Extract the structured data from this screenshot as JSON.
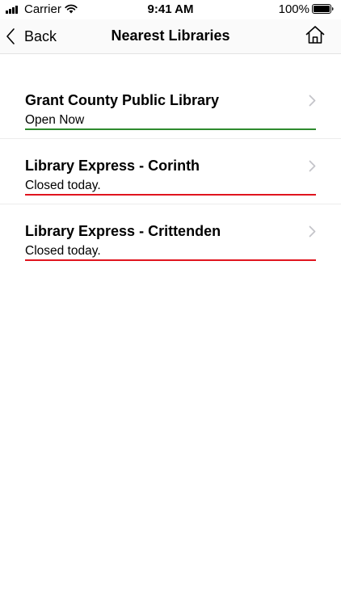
{
  "status_bar": {
    "carrier": "Carrier",
    "time": "9:41 AM",
    "battery": "100%",
    "signal_icon": "signal-bars-icon",
    "wifi_icon": "wifi-icon",
    "battery_icon": "battery-icon"
  },
  "nav": {
    "back_label": "Back",
    "title": "Nearest Libraries",
    "back_icon": "chevron-left-icon",
    "home_icon": "home-icon"
  },
  "colors": {
    "open": "#2e8b2e",
    "closed": "#e0141e",
    "chevron": "#c4c4c9"
  },
  "libraries": [
    {
      "name": "Grant County Public Library",
      "status": "Open Now",
      "state": "open"
    },
    {
      "name": "Library Express - Corinth",
      "status": "Closed today.",
      "state": "closed"
    },
    {
      "name": "Library Express - Crittenden",
      "status": "Closed today.",
      "state": "closed"
    }
  ]
}
